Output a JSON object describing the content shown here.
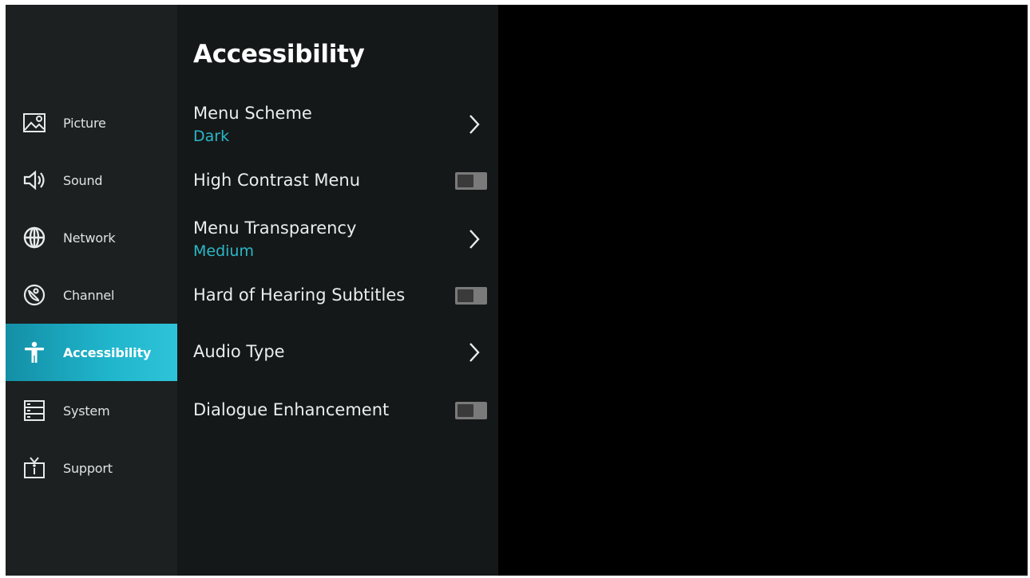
{
  "sidebar": {
    "items": [
      {
        "label": "Picture",
        "icon": "picture-icon"
      },
      {
        "label": "Sound",
        "icon": "speaker-icon"
      },
      {
        "label": "Network",
        "icon": "globe-icon"
      },
      {
        "label": "Channel",
        "icon": "satellite-dish-icon"
      },
      {
        "label": "Accessibility",
        "icon": "accessibility-icon",
        "selected": true
      },
      {
        "label": "System",
        "icon": "system-icon"
      },
      {
        "label": "Support",
        "icon": "tv-info-icon"
      }
    ]
  },
  "panel": {
    "title": "Accessibility",
    "settings": [
      {
        "label": "Menu Scheme",
        "value": "Dark",
        "control": "chevron"
      },
      {
        "label": "High Contrast Menu",
        "control": "toggle",
        "on": false
      },
      {
        "label": "Menu Transparency",
        "value": "Medium",
        "control": "chevron"
      },
      {
        "label": "Hard of Hearing Subtitles",
        "control": "toggle",
        "on": false
      },
      {
        "label": "Audio Type",
        "control": "chevron"
      },
      {
        "label": "Dialogue Enhancement",
        "control": "toggle",
        "on": false
      }
    ]
  },
  "colors": {
    "accent": "#20b5cc",
    "value_text": "#2ab8c8",
    "sidebar_bg": "#1c2020",
    "panel_bg": "#151818",
    "toggle_off": "#7a7a7a"
  }
}
